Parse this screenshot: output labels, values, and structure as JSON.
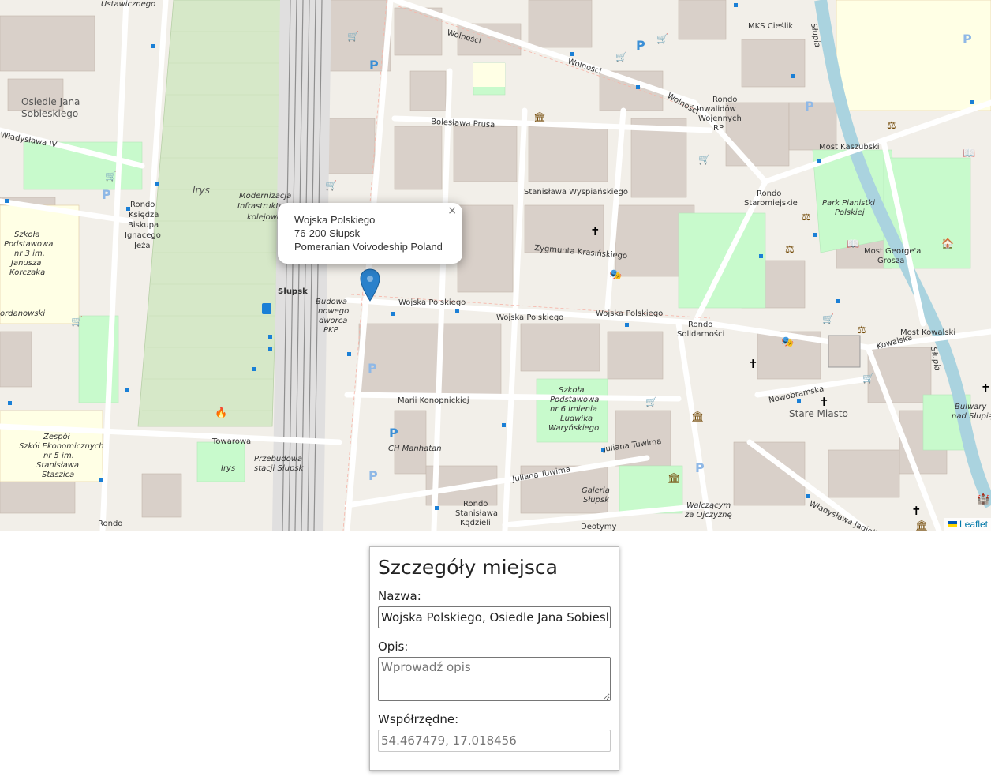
{
  "map": {
    "popup": {
      "close": "×",
      "lines": [
        "Wojska Polskiego",
        "76-200 Słupsk",
        "Pomeranian Voivodeship Poland"
      ]
    },
    "attribution": "Leaflet",
    "labels": {
      "wolnosci1": "Wolności",
      "wolnosci2": "Wolności",
      "wolnosci3": "Wolności",
      "mks": "MKS Cieślik",
      "osiedle1": "Osiedle Jana",
      "osiedle2": "Sobieskiego",
      "wladyslawa": "Władysława IV",
      "boleslawa": "Bolesława Prusa",
      "irys": "Irys",
      "modern1": "Modernizacja",
      "modern2": "Infrastruktury",
      "modern3": "kolejowej",
      "rondo_ksiedza1": "Rondo",
      "rondo_ksiedza2": "Księdza",
      "rondo_ksiedza3": "Biskupa",
      "rondo_ksiedza4": "Ignacego",
      "rondo_ksiedza5": "Jeża",
      "stanislawa_wysp": "Stanisława Wyspiańskiego",
      "zygmunta": "Zygmunta Krasińskiego",
      "slupsk_station": "Słupsk",
      "budowa1": "Budowa",
      "budowa2": "nowego",
      "budowa3": "dworca",
      "budowa4": "PKP",
      "wojska1": "Wojska Polskiego",
      "wojska2": "Wojska Polskiego",
      "wojska3": "Wojska Polskiego",
      "rondo_inw1": "Rondo",
      "rondo_inw2": "Inwalidów",
      "rondo_inw3": "Wojennych",
      "rondo_inw4": "RP",
      "most_kasz": "Most Kaszubski",
      "rondo_star1": "Rondo",
      "rondo_star2": "Staromiejskie",
      "park1": "Park Pianistki",
      "park2": "Polskiej",
      "most_george1": "Most George'a",
      "most_george2": "Grosza",
      "rondo_sol1": "Rondo",
      "rondo_sol2": "Solidarności",
      "most_kowal": "Most Kowalski",
      "kowalska": "Kowalska",
      "marii": "Marii Konopnickiej",
      "szkola1": "Szkoła",
      "szkola2": "Podstawowa",
      "szkola3": "nr 6 imienia",
      "szkola4": "Ludwika",
      "szkola5": "Waryńskiego",
      "nowobramska": "Nowobramska",
      "stare_miasto": "Stare Miasto",
      "ch_manhatan": "CH Manhatan",
      "juliana1": "Juliana Tuwima",
      "juliana2": "Juliana Tuwima",
      "zespol1": "Zespół",
      "zespol2": "Szkół Ekonomicznych",
      "zespol3": "nr 5 im.",
      "zespol4": "Stanisława",
      "zespol5": "Staszica",
      "szkola_p1": "Szkoła",
      "szkola_p2": "Podstawowa",
      "szkola_p3": "nr 3 im.",
      "szkola_p4": "Janusza",
      "szkola_p5": "Korczaka",
      "towarowa": "Towarowa",
      "irys2": "Irys",
      "przebudowa1": "Przebudowa",
      "przebudowa2": "stacji Słupsk",
      "galeria1": "Galeria",
      "galeria2": "Słupsk",
      "rondo_kadz1": "Rondo",
      "rondo_kadz2": "Stanisława",
      "rondo_kadz3": "Kądzieli",
      "deotymy": "Deotymy",
      "walczacym1": "Walczącym",
      "walczacym2": "za Ojczyznę",
      "wladyslawa_jag": "Władysława Jagiełły",
      "bulwary1": "Bulwary",
      "bulwary2": "nad Słupią",
      "ordanowski": "ordanowski",
      "slupia1": "Słupia",
      "slupia2": "Słupia",
      "rondo_bottom": "Rondo",
      "ustawicznego": "Ustawicznego"
    }
  },
  "panel": {
    "title": "Szczegóły miejsca",
    "name_label": "Nazwa:",
    "name_value": "Wojska Polskiego, Osiedle Jana Sobieskiego",
    "desc_label": "Opis:",
    "desc_placeholder": "Wprowadź opis",
    "coords_label": "Współrzędne:",
    "coords_placeholder": "54.467479, 17.018456"
  },
  "colors": {
    "map_bg": "#f2efe9",
    "building": "#d9d0c9",
    "park": "#c8facc",
    "rail_area": "#e0dfdf",
    "marker": "#2a81cb",
    "water": "#aad3df",
    "road": "#ffffff"
  }
}
